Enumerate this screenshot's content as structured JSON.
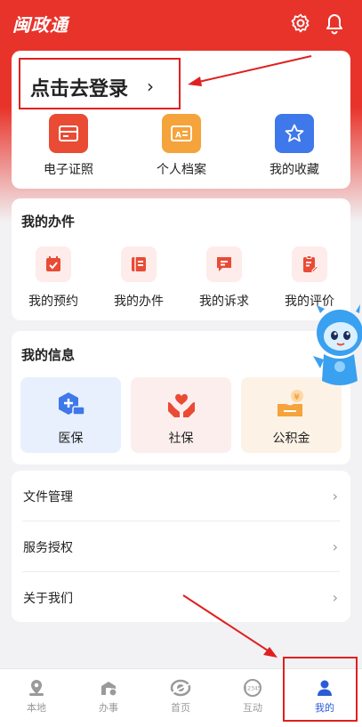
{
  "app": {
    "logo_text": "闽政通"
  },
  "login": {
    "label": "点击去登录",
    "chevron": "›"
  },
  "quick": [
    {
      "label": "电子证照",
      "icon": "card-icon",
      "color": "#e94b35"
    },
    {
      "label": "个人档案",
      "icon": "id-card-icon",
      "color": "#f5a33b"
    },
    {
      "label": "我的收藏",
      "icon": "star-icon",
      "color": "#3f78ea"
    }
  ],
  "business": {
    "title": "我的办件",
    "items": [
      {
        "label": "我的预约",
        "icon": "calendar-check-icon"
      },
      {
        "label": "我的办件",
        "icon": "document-list-icon"
      },
      {
        "label": "我的诉求",
        "icon": "message-icon"
      },
      {
        "label": "我的评价",
        "icon": "clipboard-edit-icon"
      }
    ]
  },
  "info": {
    "title": "我的信息",
    "tiles": [
      {
        "label": "医保",
        "icon": "medical-insurance-icon",
        "bg": "#e8f0fd",
        "color": "#3f78ea"
      },
      {
        "label": "社保",
        "icon": "social-security-icon",
        "bg": "#fdeeee",
        "color": "#e94b35"
      },
      {
        "label": "公积金",
        "icon": "housing-fund-icon",
        "bg": "#fdf2e6",
        "color": "#f5a33b"
      }
    ]
  },
  "menu": [
    {
      "label": "文件管理",
      "chevron": "›"
    },
    {
      "label": "服务授权",
      "chevron": "›"
    },
    {
      "label": "关于我们",
      "chevron": "›"
    }
  ],
  "tabs": [
    {
      "label": "本地",
      "icon": "location-icon"
    },
    {
      "label": "办事",
      "icon": "service-hall-icon"
    },
    {
      "label": "首页",
      "icon": "home-logo-icon"
    },
    {
      "label": "互动",
      "icon": "hotline-icon"
    },
    {
      "label": "我的",
      "icon": "person-icon",
      "active": true
    }
  ],
  "colors": {
    "brand_red": "#e8332b",
    "active_blue": "#2b5bd7",
    "annotation_red": "#e02020"
  }
}
